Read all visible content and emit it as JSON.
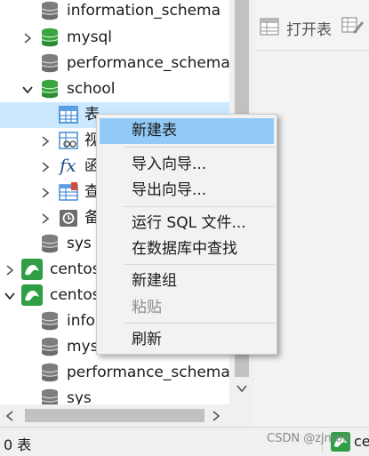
{
  "navigator": {
    "items": [
      {
        "label": "information_schema",
        "icon": "database-icon"
      },
      {
        "label": "mysql",
        "icon": "database-green-icon"
      },
      {
        "label": "performance_schema",
        "icon": "database-icon"
      },
      {
        "label": "school",
        "icon": "database-green-icon"
      },
      {
        "label": "表",
        "icon": "table-icon"
      },
      {
        "label": "视",
        "icon": "view-icon"
      },
      {
        "label": "函",
        "icon": "function-icon"
      },
      {
        "label": "查",
        "icon": "query-icon"
      },
      {
        "label": "备",
        "icon": "backup-icon"
      },
      {
        "label": "sys",
        "icon": "database-icon"
      },
      {
        "label": "centos",
        "icon": "mysql-connection-icon"
      },
      {
        "label": "centos",
        "icon": "mysql-connection-icon"
      },
      {
        "label": "infor",
        "icon": "database-icon"
      },
      {
        "label": "mysq",
        "icon": "database-icon"
      },
      {
        "label": "performance_schema",
        "icon": "database-icon"
      },
      {
        "label": "sys",
        "icon": "database-icon"
      }
    ]
  },
  "toolbar": {
    "open_table_label": "打开表"
  },
  "context_menu": {
    "items": [
      {
        "label": "新建表",
        "state": "highlighted"
      },
      {
        "label": "导入向导...",
        "state": "normal"
      },
      {
        "label": "导出向导...",
        "state": "normal"
      },
      {
        "label": "运行 SQL 文件...",
        "state": "normal"
      },
      {
        "label": "在数据库中查找",
        "state": "normal"
      },
      {
        "label": "新建组",
        "state": "normal"
      },
      {
        "label": "粘贴",
        "state": "disabled"
      },
      {
        "label": "刷新",
        "state": "normal"
      }
    ]
  },
  "status_bar": {
    "left_text": "0 表",
    "connection_label": "ce"
  },
  "watermark": "CSDN @zjmoli",
  "colors": {
    "selection": "#cce8ff",
    "menu_highlight": "#91c9f7",
    "db_active": "#3aa53f",
    "db_inactive": "#7a7a7a",
    "mysql_green": "#2f9e44"
  }
}
